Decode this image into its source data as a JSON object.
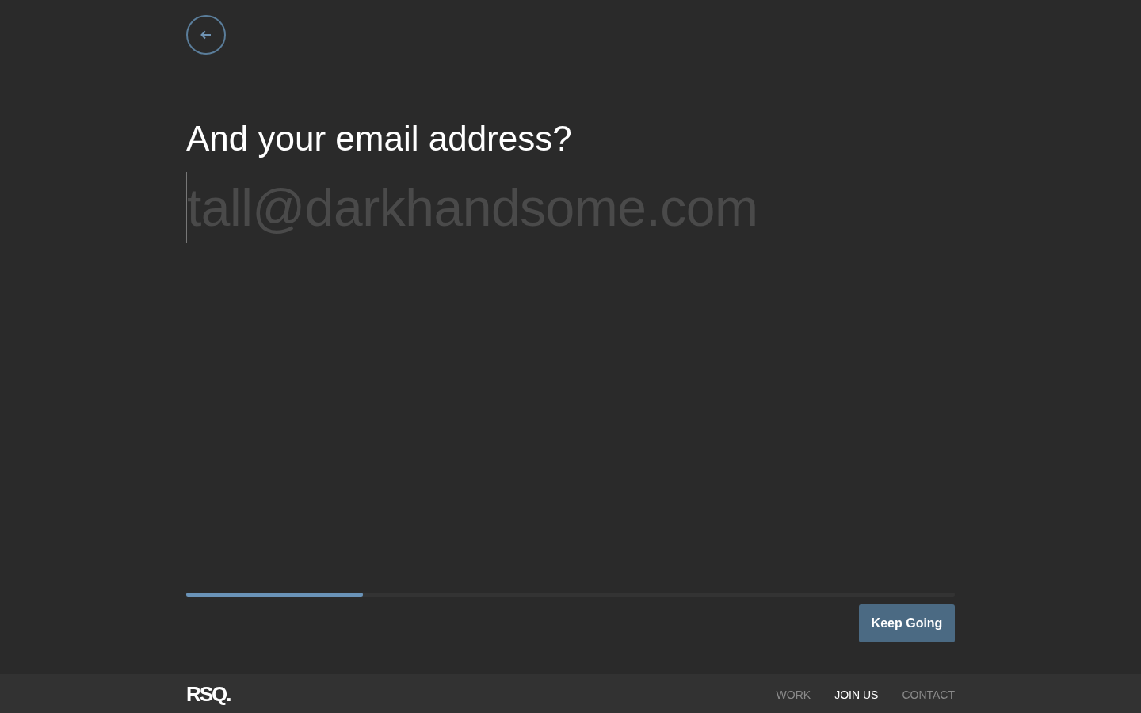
{
  "question": "And your email address?",
  "email_field": {
    "placeholder": "tall@darkhandsome.com"
  },
  "progress": {
    "level": 0.23
  },
  "button": "Keep Going",
  "footer": {
    "logo": "RSQ.",
    "nav": [
      {
        "label": "WORK",
        "selected": false
      },
      {
        "label": "JOIN US",
        "selected": true
      },
      {
        "label": "CONTACT",
        "selected": false
      }
    ]
  }
}
